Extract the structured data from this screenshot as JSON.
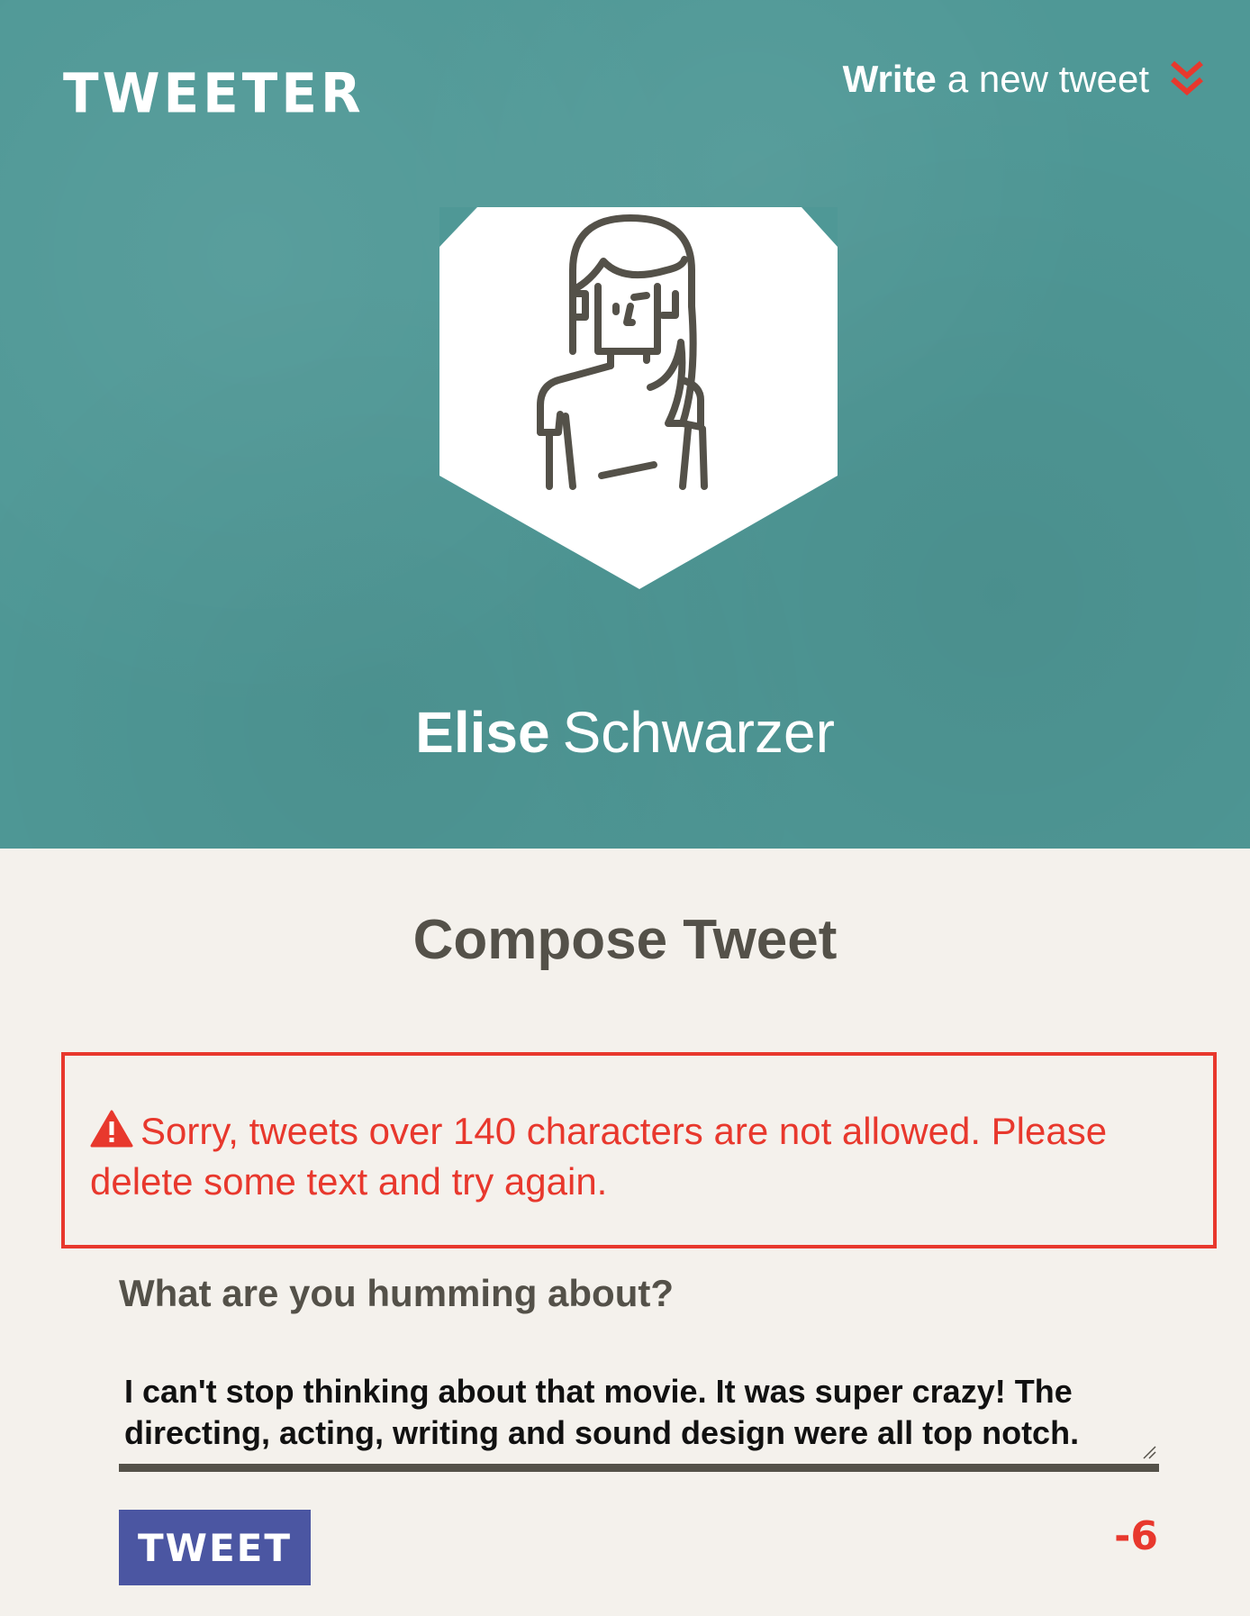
{
  "header": {
    "logo": "TWEETER",
    "write_link": {
      "bold": "Write",
      "rest": "a new tweet",
      "icon": "double-chevron-down-icon"
    }
  },
  "profile": {
    "avatar_icon": "woman-avatar-icon",
    "first_name": "Elise",
    "last_name": "Schwarzer"
  },
  "compose": {
    "title": "Compose Tweet",
    "error": {
      "icon": "warning-icon",
      "message": "Sorry, tweets over 140 characters are not allowed. Please delete some text and try again."
    },
    "prompt_label": "What are you humming about?",
    "tweet_text": "I can't stop thinking about that movie. It was super crazy! The directing, acting, writing and sound design were all top notch.",
    "tweet_button": "TWEET",
    "char_counter": "-6"
  },
  "colors": {
    "hero_bg": "#4f9896",
    "page_bg": "#f4f1ec",
    "text": "#545149",
    "error": "#e8382d",
    "button": "#4b56a2"
  }
}
